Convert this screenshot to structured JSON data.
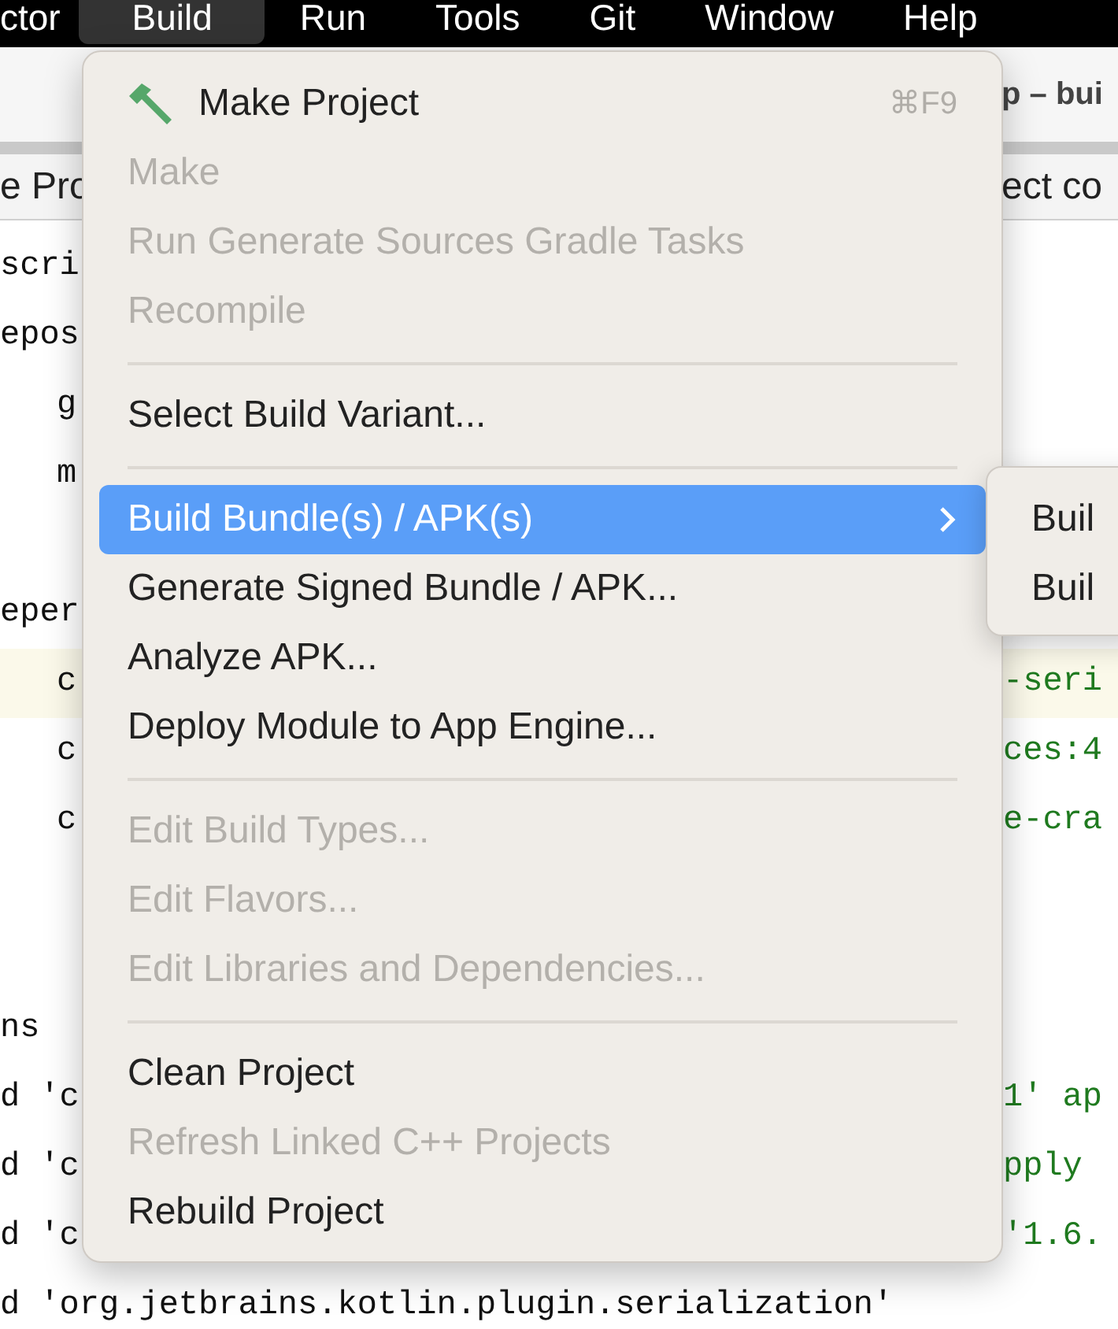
{
  "menu_bar": [
    {
      "label": "ctor",
      "selected": false
    },
    {
      "label": "Build",
      "selected": true
    },
    {
      "label": "Run",
      "selected": false
    },
    {
      "label": "Tools",
      "selected": false
    },
    {
      "label": "Git",
      "selected": false
    },
    {
      "label": "Window",
      "selected": false
    },
    {
      "label": "Help",
      "selected": false
    }
  ],
  "window": {
    "title": "p – bui"
  },
  "tabs": {
    "left": "e Pro",
    "right": "ect co"
  },
  "editor": {
    "lines": [
      {
        "left": "scri",
        "indent": false,
        "highlighted": false
      },
      {
        "left": "epos",
        "indent": false,
        "highlighted": false
      },
      {
        "left": "g",
        "indent": true,
        "highlighted": false
      },
      {
        "left": "m",
        "indent": true,
        "highlighted": false
      },
      {
        "highlighted": false
      },
      {
        "left": "eper",
        "indent": false,
        "highlighted": false
      },
      {
        "left": "c",
        "right": "-seri",
        "indent": true,
        "highlighted": true
      },
      {
        "left": "c",
        "right": "ces:4",
        "indent": true,
        "highlighted": false
      },
      {
        "left": "c",
        "right": "e-cra",
        "indent": true,
        "highlighted": false
      },
      {
        "highlighted": false
      },
      {
        "highlighted": false
      },
      {
        "left": "ns",
        "indent": false,
        "highlighted": false
      },
      {
        "left": "d 'c",
        "right": "1' ap",
        "indent": false,
        "highlighted": false
      },
      {
        "left": "d 'c",
        "right": "pply",
        "indent": false,
        "highlighted": false
      },
      {
        "left": "d 'c",
        "right": "'1.6.",
        "indent": false,
        "highlighted": false
      },
      {
        "left": "d 'org.jetbrains.kotlin.plugin.serialization'",
        "indent": false,
        "highlighted": false
      }
    ]
  },
  "build_menu": {
    "items": [
      {
        "kind": "item",
        "label": "Make Project",
        "shortcut": "⌘F9",
        "has_icon": true,
        "disabled": false,
        "selected": false,
        "submenu": false
      },
      {
        "kind": "item",
        "label": "Make",
        "disabled": true,
        "selected": false,
        "submenu": false
      },
      {
        "kind": "item",
        "label": "Run Generate Sources Gradle Tasks",
        "disabled": true,
        "selected": false,
        "submenu": false
      },
      {
        "kind": "item",
        "label": "Recompile",
        "disabled": true,
        "selected": false,
        "submenu": false
      },
      {
        "kind": "separator"
      },
      {
        "kind": "item",
        "label": "Select Build Variant...",
        "disabled": false,
        "selected": false,
        "submenu": false
      },
      {
        "kind": "separator"
      },
      {
        "kind": "item",
        "label": "Build Bundle(s) / APK(s)",
        "disabled": false,
        "selected": true,
        "submenu": true
      },
      {
        "kind": "item",
        "label": "Generate Signed Bundle / APK...",
        "disabled": false,
        "selected": false,
        "submenu": false
      },
      {
        "kind": "item",
        "label": "Analyze APK...",
        "disabled": false,
        "selected": false,
        "submenu": false
      },
      {
        "kind": "item",
        "label": "Deploy Module to App Engine...",
        "disabled": false,
        "selected": false,
        "submenu": false
      },
      {
        "kind": "separator"
      },
      {
        "kind": "item",
        "label": "Edit Build Types...",
        "disabled": true,
        "selected": false,
        "submenu": false
      },
      {
        "kind": "item",
        "label": "Edit Flavors...",
        "disabled": true,
        "selected": false,
        "submenu": false
      },
      {
        "kind": "item",
        "label": "Edit Libraries and Dependencies...",
        "disabled": true,
        "selected": false,
        "submenu": false
      },
      {
        "kind": "separator"
      },
      {
        "kind": "item",
        "label": "Clean Project",
        "disabled": false,
        "selected": false,
        "submenu": false
      },
      {
        "kind": "item",
        "label": "Refresh Linked C++ Projects",
        "disabled": true,
        "selected": false,
        "submenu": false
      },
      {
        "kind": "item",
        "label": "Rebuild Project",
        "disabled": false,
        "selected": false,
        "submenu": false
      }
    ]
  },
  "submenu": {
    "items": [
      {
        "label": "Buil"
      },
      {
        "label": "Buil"
      }
    ]
  }
}
